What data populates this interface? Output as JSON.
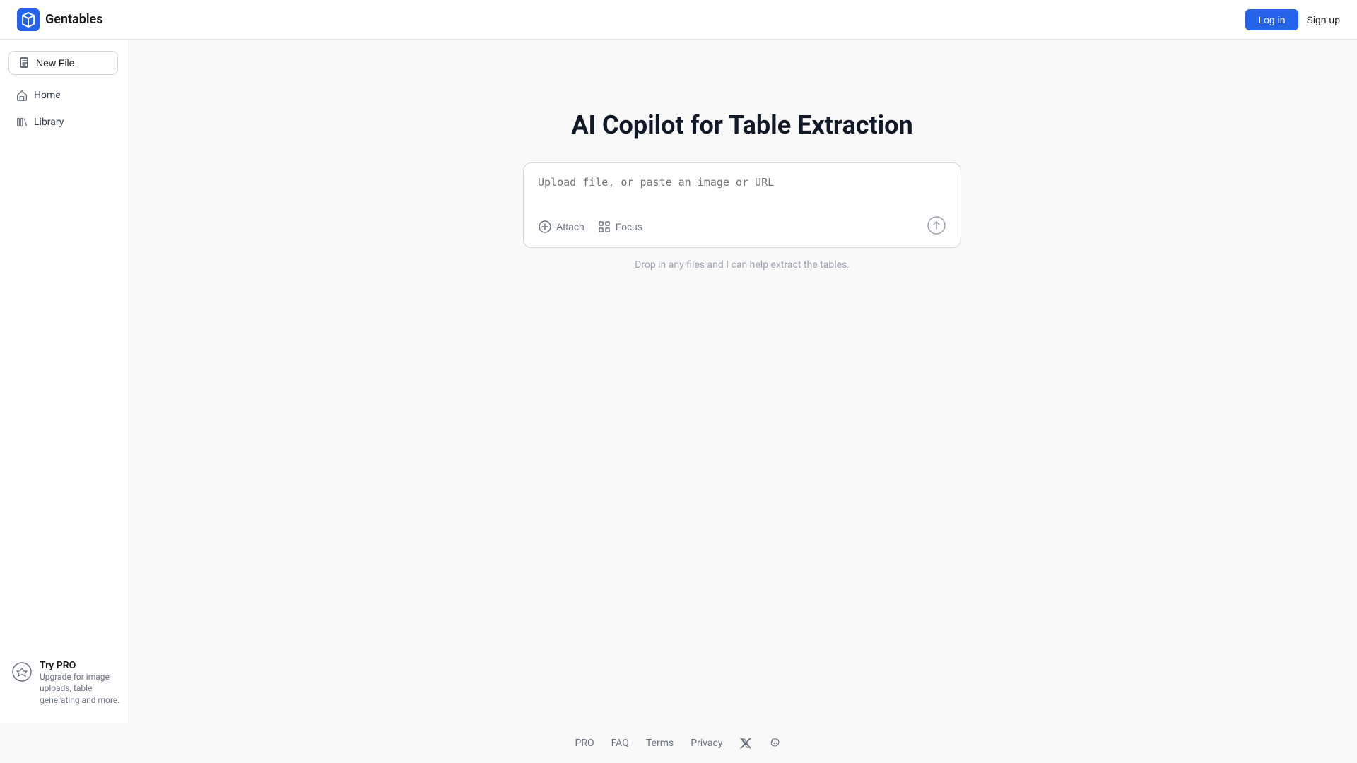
{
  "header": {
    "logo_text": "Gentables",
    "login_label": "Log in",
    "signup_label": "Sign up"
  },
  "sidebar": {
    "new_file_label": "New File",
    "nav_items": [
      {
        "id": "home",
        "label": "Home"
      },
      {
        "id": "library",
        "label": "Library"
      }
    ]
  },
  "main": {
    "title": "AI Copilot for Table Extraction",
    "upload_placeholder": "Upload file, or paste an image or URL",
    "attach_label": "Attach",
    "focus_label": "Focus",
    "drop_hint": "Drop in any files and I can help extract the tables."
  },
  "try_pro": {
    "title": "Try PRO",
    "description": "Upgrade for image uploads, table generating and more."
  },
  "footer": {
    "links": [
      {
        "id": "pro",
        "label": "PRO"
      },
      {
        "id": "faq",
        "label": "FAQ"
      },
      {
        "id": "terms",
        "label": "Terms"
      },
      {
        "id": "privacy",
        "label": "Privacy"
      }
    ]
  }
}
